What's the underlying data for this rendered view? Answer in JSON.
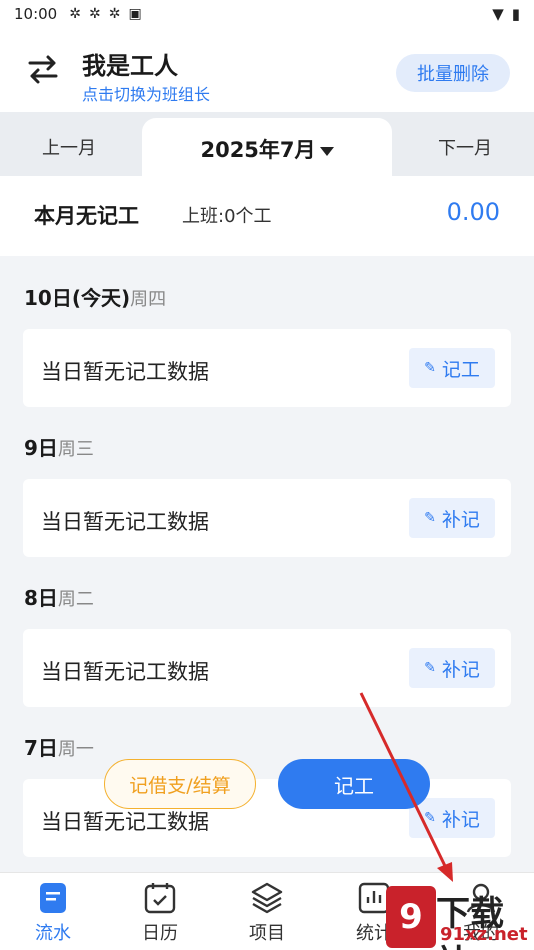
{
  "status": {
    "time": "10:00"
  },
  "header": {
    "title": "我是工人",
    "subtitle": "点击切换为班组长",
    "batch_delete": "批量删除"
  },
  "month": {
    "prev": "上一月",
    "current": "2025年7月",
    "next": "下一月"
  },
  "summary": {
    "no_record": "本月无记工",
    "shift": "上班:0个工",
    "amount": "0.00"
  },
  "days": [
    {
      "date": "10日(今天)",
      "weekday": "周四",
      "message": "当日暂无记工数据",
      "action": "记工"
    },
    {
      "date": "9日",
      "weekday": "周三",
      "message": "当日暂无记工数据",
      "action": "补记"
    },
    {
      "date": "8日",
      "weekday": "周二",
      "message": "当日暂无记工数据",
      "action": "补记"
    },
    {
      "date": "7日",
      "weekday": "周一",
      "message": "当日暂无记工数据",
      "action": "补记"
    }
  ],
  "floating": {
    "loan_settle": "记借支/结算",
    "record": "记工"
  },
  "nav": [
    {
      "label": "流水",
      "icon": "document-icon"
    },
    {
      "label": "日历",
      "icon": "calendar-icon"
    },
    {
      "label": "项目",
      "icon": "layers-icon"
    },
    {
      "label": "统计",
      "icon": "chart-icon"
    },
    {
      "label": "我的",
      "icon": "user-icon"
    }
  ],
  "watermark": {
    "badge": "9",
    "line1": "下载站",
    "line2": "91xz.net"
  },
  "colors": {
    "accent": "#2f7bf0",
    "warning": "#f0a020",
    "annotation": "#d62a2a"
  }
}
